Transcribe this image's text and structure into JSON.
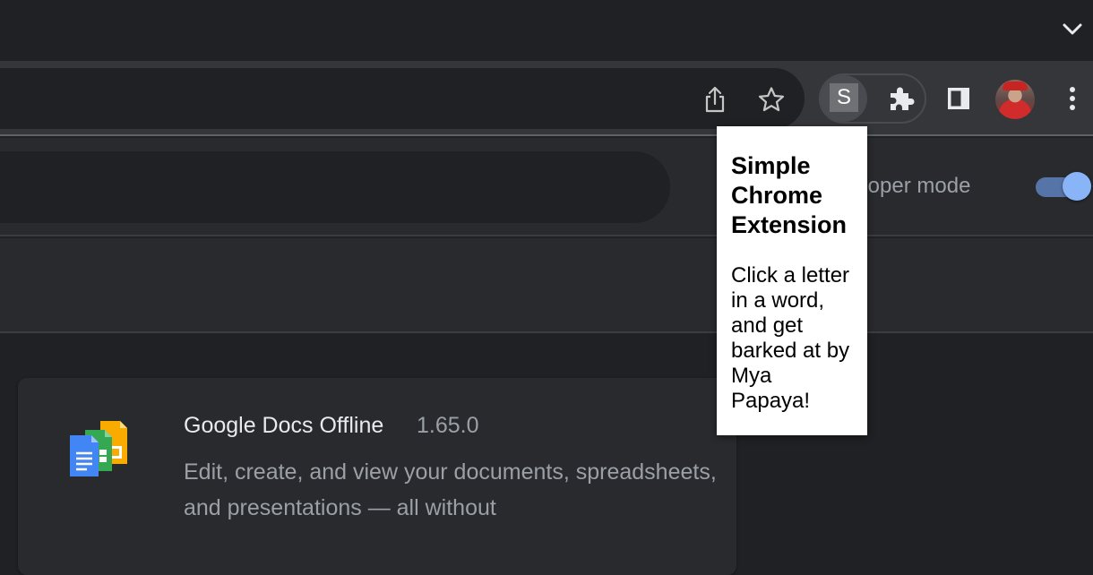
{
  "tabstrip": {
    "tab_search_icon": "chevron-down-icon"
  },
  "toolbar": {
    "share_icon": "share-icon",
    "bookmark_icon": "star-icon",
    "active_extension_letter": "S",
    "extensions_icon": "puzzle-icon",
    "side_panel_icon": "side-panel-icon",
    "menu_icon": "more-vertical-icon"
  },
  "page": {
    "developer_mode_label": "eloper mode",
    "developer_mode_on": true
  },
  "extension_card": {
    "name": "Google Docs Offline",
    "version": "1.65.0",
    "description": "Edit, create, and view your documents, spreadsheets, and presentations — all without"
  },
  "popup": {
    "title": "Simple Chrome Extension",
    "text": "Click a letter in a word, and get barked at by Mya Papaya!"
  },
  "colors": {
    "accent": "#8ab4f8",
    "background": "#202124",
    "toolbar": "#35363a",
    "text_primary": "#e8eaed",
    "text_secondary": "#9aa0a6"
  }
}
